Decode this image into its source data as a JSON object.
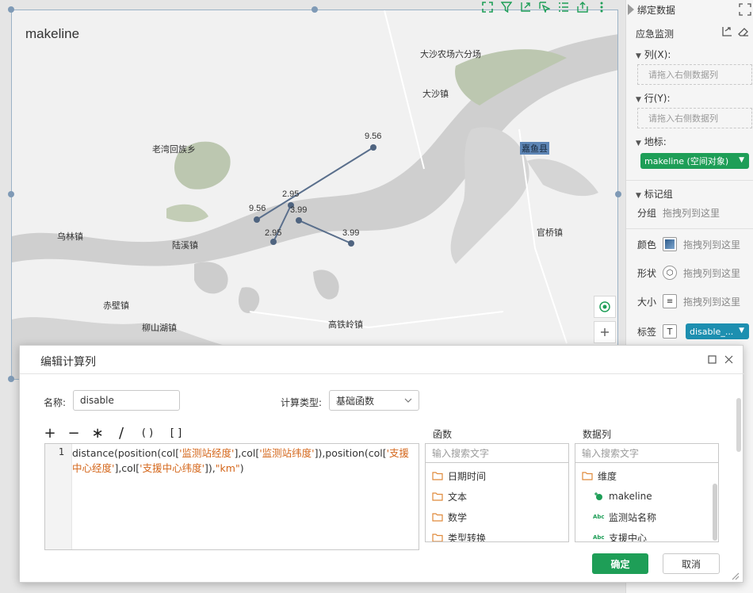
{
  "chart": {
    "title": "makeline",
    "places": [
      "大沙农场六分场",
      "大沙镇",
      "老湾回族乡",
      "嘉鱼县",
      "乌林镇",
      "陆溪镇",
      "官桥镇",
      "赤壁镇",
      "柳山湖镇",
      "高铁岭镇"
    ],
    "value_labels": [
      "9.56",
      "9.56",
      "2.95",
      "2.95",
      "3.99",
      "3.99"
    ]
  },
  "toolbar": {
    "icons": [
      "fullscreen-icon",
      "filter-icon",
      "drill-icon",
      "select-icon",
      "list-icon",
      "export-icon",
      "more-icon"
    ]
  },
  "right_panel": {
    "title": "绑定数据",
    "dataset": "应急监测",
    "columns_label": "列(X):",
    "columns_placeholder": "请拖入右侧数据列",
    "rows_label": "行(Y):",
    "rows_placeholder": "请拖入右侧数据列",
    "geo_label": "地标:",
    "geo_pill": "makeline (空间对象)",
    "marks_label": "标记组",
    "group_label": "分组",
    "group_hint": "拖拽列到这里",
    "color_label": "颜色",
    "shape_label": "形状",
    "size_label": "大小",
    "label_label": "标签",
    "drag_hint": "拖拽列到这里",
    "label_pill": "disable_..."
  },
  "dialog": {
    "title": "编辑计算列",
    "name_label": "名称:",
    "name_value": "disable",
    "calc_type_label": "计算类型:",
    "calc_type_value": "基础函数",
    "operators": [
      "+",
      "−",
      "∗",
      "/",
      "( )",
      "[ ]"
    ],
    "line_number": "1",
    "code": {
      "p1": "distance(position(col[",
      "s1": "'监测站经度'",
      "p2": "],col[",
      "s2": "'监测站纬度'",
      "p3": "]),position(col[",
      "s3": "'支援中心经度'",
      "p4": "],col[",
      "s4": "'支援中心纬度'",
      "p5": "]),",
      "s5": "\"km\"",
      "p6": ")"
    },
    "functions_header": "函数",
    "functions_search": "输入搜索文字",
    "functions": [
      "日期时间",
      "文本",
      "数学",
      "类型转换"
    ],
    "columns_header": "数据列",
    "columns_search": "输入搜索文字",
    "dimension_folder": "维度",
    "columns": [
      "makeline",
      "监测站名称",
      "支援中心"
    ],
    "abc_tag": "Abc",
    "ok_label": "确定",
    "cancel_label": "取消"
  },
  "colors": {
    "accent_green": "#1e9e57",
    "accent_teal": "#1d8fb0",
    "string_orange": "#d4661a",
    "route_line": "#5a6f8c"
  }
}
